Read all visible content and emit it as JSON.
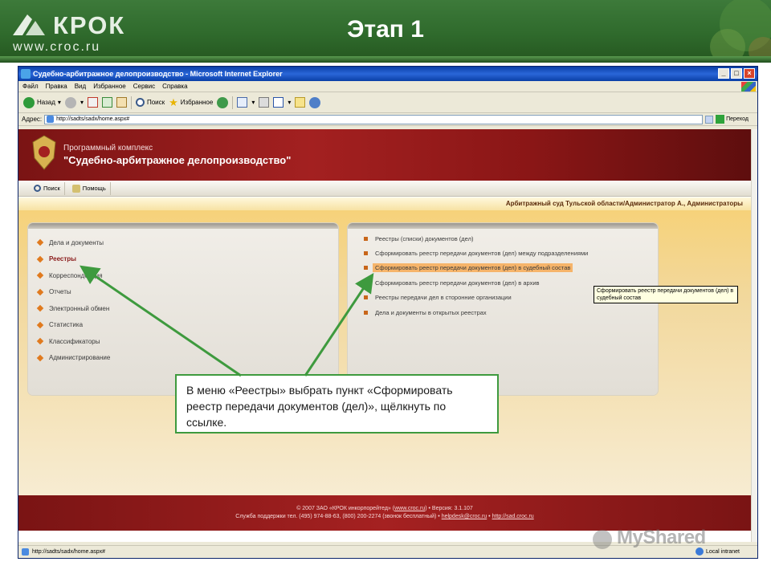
{
  "slide": {
    "logo_text": "КРОК",
    "logo_url": "www.croc.ru",
    "title": "Этап 1"
  },
  "browser": {
    "window_title": "Судебно-арбитражное делопроизводство - Microsoft Internet Explorer",
    "menu": [
      "Файл",
      "Правка",
      "Вид",
      "Избранное",
      "Сервис",
      "Справка"
    ],
    "toolbar": {
      "back": "Назад",
      "search": "Поиск",
      "favorites": "Избранное"
    },
    "address_label": "Адрес:",
    "address_value": "http://sadts/sadx/home.aspx#",
    "go_label": "Переход",
    "status_url": "http://sadts/sadx/home.aspx#",
    "status_zone": "Local intranet"
  },
  "app": {
    "subtitle": "Программный комплекс",
    "title": "\"Судебно-арбитражное делопроизводство\"",
    "toolbar": {
      "search": "Поиск",
      "help": "Помощь"
    },
    "org_info": "Арбитражный суд Тульской области/Администратор А., Администраторы",
    "main_menu": [
      "Дела и документы",
      "Реестры",
      "Корреспонденция",
      "Отчеты",
      "Электронный обмен",
      "Статистика",
      "Классификаторы",
      "Администрирование"
    ],
    "registry_submenu": [
      "Реестры (списки) документов (дел)",
      "Сформировать реестр передачи документов (дел) между подразделениями",
      "Сформировать реестр передачи документов (дел) в судебный состав",
      "Сформировать реестр передачи документов (дел) в архив",
      "Реестры передачи дел в сторонние организации",
      "Дела и документы в открытых реестрах"
    ],
    "tooltip": "Сформировать реестр передачи документов (дел) в судебный состав",
    "footer_line1_prefix": "© 2007 ЗАО «КРОК инкорпорейтед» (",
    "footer_line1_link": "www.croc.ru",
    "footer_line1_suffix": ") • Версия: 3.1.107",
    "footer_line2_prefix": "Служба поддержки тел. (495) 974-88-63, (800) 200-2274 (звонок бесплатный) • ",
    "footer_line2_link1": "helpdesk@croc.ru",
    "footer_line2_sep": " • ",
    "footer_line2_link2": "http://sad.croc.ru"
  },
  "callout": "В меню «Реестры» выбрать пункт «Сформировать реестр передачи документов (дел)», щёлкнуть по ссылке.",
  "watermark": "MyShared",
  "colors": {
    "header_green": "#2f6a2c",
    "app_red": "#a32020",
    "callout_border": "#3e9a3e",
    "highlight": "#f6b46a"
  }
}
